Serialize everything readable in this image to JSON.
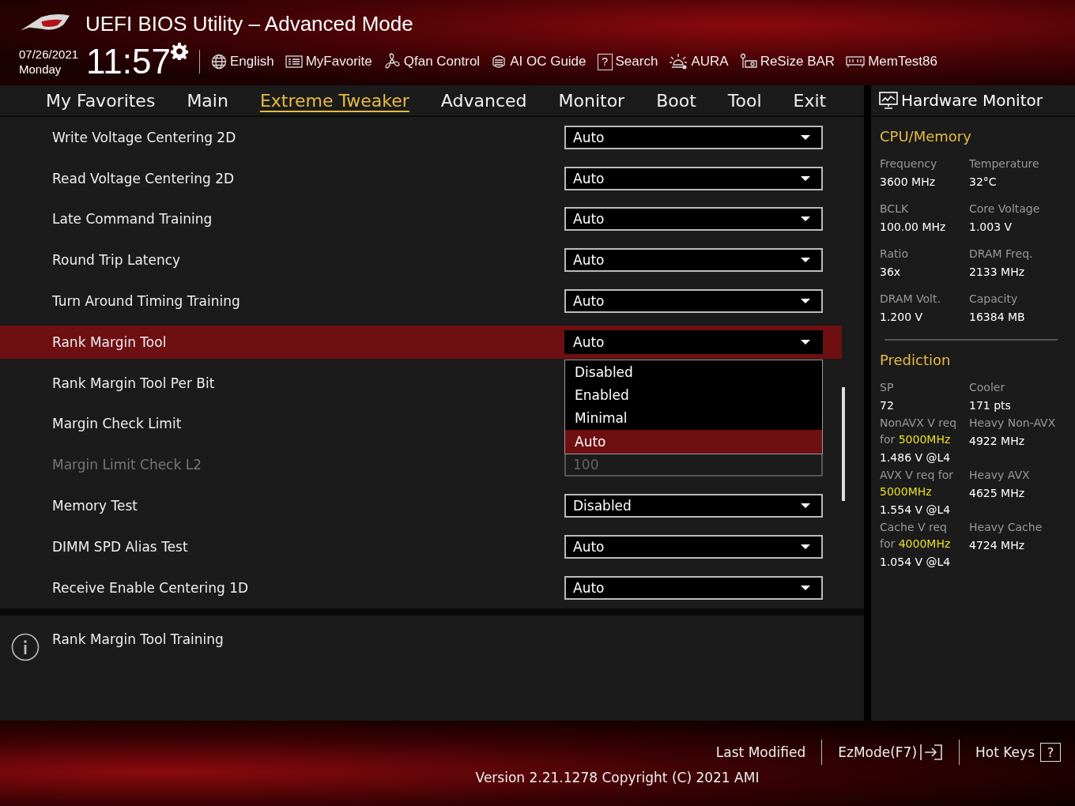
{
  "header": {
    "title": "UEFI BIOS Utility – Advanced Mode",
    "date": "07/26/2021",
    "day": "Monday",
    "time": "11:57",
    "toolbar": [
      {
        "label": "English",
        "kind": "globe"
      },
      {
        "label": "MyFavorite",
        "kind": "list"
      },
      {
        "label": "Qfan Control",
        "kind": "fan"
      },
      {
        "label": "AI OC Guide",
        "kind": "chip"
      },
      {
        "label": "Search",
        "kind": "search",
        "glyph": "?"
      },
      {
        "label": "AURA",
        "kind": "light"
      },
      {
        "label": "ReSize BAR",
        "kind": "card"
      },
      {
        "label": "MemTest86",
        "kind": "memory"
      }
    ]
  },
  "tabs": [
    {
      "label": "My Favorites",
      "selected": false
    },
    {
      "label": "Main",
      "selected": false
    },
    {
      "label": "Extreme Tweaker",
      "selected": true
    },
    {
      "label": "Advanced",
      "selected": false
    },
    {
      "label": "Monitor",
      "selected": false
    },
    {
      "label": "Boot",
      "selected": false
    },
    {
      "label": "Tool",
      "selected": false
    },
    {
      "label": "Exit",
      "selected": false
    }
  ],
  "settings": [
    {
      "label": "Write Voltage Centering 2D",
      "kind": "dropdown",
      "value": "Auto",
      "selected": false,
      "disabled": false
    },
    {
      "label": "Read Voltage Centering 2D",
      "kind": "dropdown",
      "value": "Auto",
      "selected": false,
      "disabled": false
    },
    {
      "label": "Late Command Training",
      "kind": "dropdown",
      "value": "Auto",
      "selected": false,
      "disabled": false
    },
    {
      "label": "Round Trip Latency",
      "kind": "dropdown",
      "value": "Auto",
      "selected": false,
      "disabled": false
    },
    {
      "label": "Turn Around Timing Training",
      "kind": "dropdown",
      "value": "Auto",
      "selected": false,
      "disabled": false
    },
    {
      "label": "Rank Margin Tool",
      "kind": "dropdown",
      "value": "Auto",
      "selected": true,
      "disabled": false,
      "options": [
        {
          "label": "Disabled",
          "selected": false
        },
        {
          "label": "Enabled",
          "selected": false
        },
        {
          "label": "Minimal",
          "selected": false
        },
        {
          "label": "Auto",
          "selected": true
        }
      ]
    },
    {
      "label": "Rank Margin Tool Per Bit",
      "selected": false,
      "disabled": false
    },
    {
      "label": "Margin Check Limit",
      "selected": false,
      "disabled": false
    },
    {
      "label": "Margin Limit Check L2",
      "kind": "number",
      "value": "100",
      "selected": false,
      "disabled": true
    },
    {
      "label": "Memory Test",
      "kind": "dropdown",
      "value": "Disabled",
      "selected": false,
      "disabled": false
    },
    {
      "label": "DIMM SPD Alias Test",
      "kind": "dropdown",
      "value": "Auto",
      "selected": false,
      "disabled": false
    },
    {
      "label": "Receive Enable Centering 1D",
      "kind": "dropdown",
      "value": "Auto",
      "selected": false,
      "disabled": false
    }
  ],
  "help": {
    "text": "Rank Margin Tool Training"
  },
  "hardware_monitor": {
    "title": "Hardware Monitor",
    "sections": [
      {
        "title": "CPU/Memory",
        "items": [
          {
            "label": "Frequency",
            "value": "3600 MHz"
          },
          {
            "label": "Temperature",
            "value": "32°C"
          },
          {
            "label": "BCLK",
            "value": "100.00 MHz"
          },
          {
            "label": "Core Voltage",
            "value": "1.003 V"
          },
          {
            "label": "Ratio",
            "value": "36x"
          },
          {
            "label": "DRAM Freq.",
            "value": "2133 MHz"
          },
          {
            "label": "DRAM Volt.",
            "value": "1.200 V"
          },
          {
            "label": "Capacity",
            "value": "16384 MB"
          }
        ]
      },
      {
        "title": "Prediction",
        "items": [
          {
            "label": "SP",
            "value": "72"
          },
          {
            "label": "Cooler",
            "value": "171 pts"
          },
          {
            "label": "NonAVX V req for **5000MHz**",
            "value": "1.486 V @L4"
          },
          {
            "label": "Heavy Non-AVX",
            "value": "4922 MHz"
          },
          {
            "label": "AVX V req for **5000MHz**",
            "value": "1.554 V @L4"
          },
          {
            "label": "Heavy AVX",
            "value": "4625 MHz"
          },
          {
            "label": "Cache V req for **4000MHz**",
            "value": "1.054 V @L4"
          },
          {
            "label": "Heavy Cache",
            "value": "4724 MHz"
          }
        ]
      }
    ]
  },
  "footer": {
    "actions": [
      {
        "label": "Last Modified",
        "kind": "plain"
      },
      {
        "label": "EzMode(F7)",
        "kind": "exit"
      },
      {
        "label": "Hot Keys",
        "kind": "key",
        "glyph": "?"
      }
    ],
    "version": "Version 2.21.1278 Copyright (C) 2021 AMI"
  }
}
